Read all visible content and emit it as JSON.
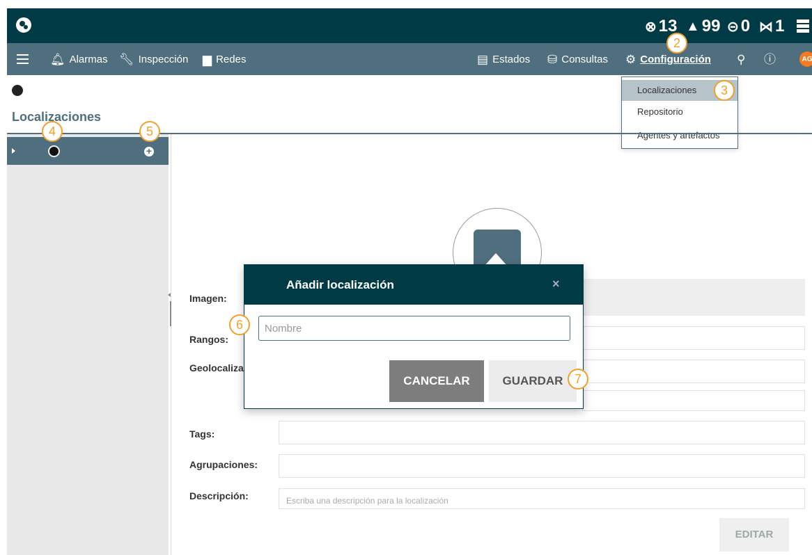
{
  "topbar": {
    "status": [
      {
        "icon": "error-icon",
        "glyph": "⊗",
        "value": "13"
      },
      {
        "icon": "warning-icon",
        "glyph": "▲",
        "value": "99"
      },
      {
        "icon": "link-icon",
        "glyph": "⊝",
        "value": "0"
      },
      {
        "icon": "unlink-icon",
        "glyph": "⋈",
        "value": "1"
      }
    ]
  },
  "nav": {
    "items": [
      {
        "icon": "bell-icon",
        "label": "Alarmas"
      },
      {
        "icon": "wrench-icon",
        "label": "Inspección"
      },
      {
        "icon": "monitor-icon",
        "label": "Redes"
      },
      {
        "icon": "dashboard-icon",
        "label": "Estados"
      },
      {
        "icon": "database-search-icon",
        "label": "Consultas"
      },
      {
        "icon": "gear-icon",
        "label": "Configuración"
      }
    ],
    "avatar": "AG"
  },
  "dropdown": {
    "items": [
      "Localizaciones",
      "Repositorio",
      "Agentes y artefactos"
    ],
    "active": "Localizaciones"
  },
  "page": {
    "title": "Localizaciones"
  },
  "form": {
    "labels": {
      "image": "Imagen:",
      "ranges": "Rangos:",
      "geo": "Geolocaliza",
      "tags": "Tags:",
      "groups": "Agrupaciones:",
      "description": "Descripción:"
    },
    "description_placeholder": "Escriba una descripción para la localización",
    "edit_label": "EDITAR"
  },
  "modal": {
    "title": "Añadir localización",
    "close": "×",
    "name_placeholder": "Nombre",
    "cancel_label": "CANCELAR",
    "save_label": "GUARDAR"
  },
  "callouts": [
    "2",
    "3",
    "4",
    "5",
    "6",
    "7"
  ],
  "colors": {
    "primary_dark": "#003a45",
    "primary": "#4f6e7e",
    "accent": "#f0a030",
    "avatar": "#f47b20"
  }
}
